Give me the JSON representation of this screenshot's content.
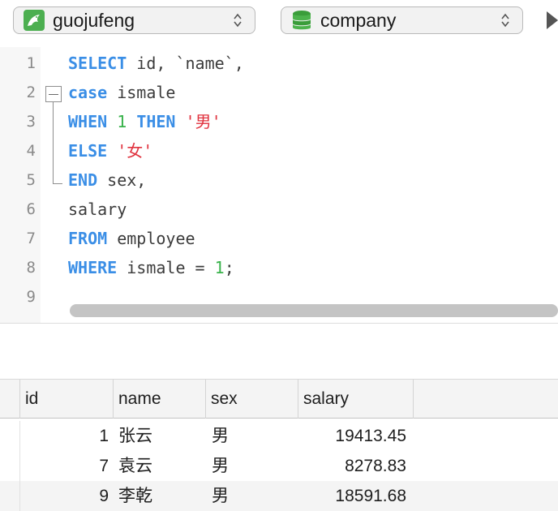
{
  "toolbar": {
    "connection": {
      "label": "guojufeng",
      "icon": "mysql-dolphin-icon"
    },
    "database": {
      "label": "company",
      "icon": "database-stack-icon"
    },
    "colors": {
      "connection_icon": "#4caf50",
      "database_icon": "#3a9d3a"
    }
  },
  "editor": {
    "line_numbers": [
      "1",
      "2",
      "3",
      "4",
      "5",
      "6",
      "7",
      "8",
      "9"
    ],
    "lines": [
      [
        {
          "t": "SELECT",
          "c": "kw"
        },
        {
          "t": " id, `name`,",
          "c": "plain"
        }
      ],
      [
        {
          "t": "case",
          "c": "kw"
        },
        {
          "t": " ismale",
          "c": "plain"
        }
      ],
      [
        {
          "t": "WHEN",
          "c": "kw"
        },
        {
          "t": " ",
          "c": "plain"
        },
        {
          "t": "1",
          "c": "num"
        },
        {
          "t": " ",
          "c": "plain"
        },
        {
          "t": "THEN",
          "c": "kw"
        },
        {
          "t": " ",
          "c": "plain"
        },
        {
          "t": "'男'",
          "c": "str"
        }
      ],
      [
        {
          "t": "ELSE",
          "c": "kw"
        },
        {
          "t": " ",
          "c": "plain"
        },
        {
          "t": "'女'",
          "c": "str"
        }
      ],
      [
        {
          "t": "END",
          "c": "kw"
        },
        {
          "t": " sex,",
          "c": "plain"
        }
      ],
      [
        {
          "t": "salary",
          "c": "plain"
        }
      ],
      [
        {
          "t": "FROM",
          "c": "kw"
        },
        {
          "t": " employee",
          "c": "plain"
        }
      ],
      [
        {
          "t": "WHERE",
          "c": "kw"
        },
        {
          "t": " ismale = ",
          "c": "plain"
        },
        {
          "t": "1",
          "c": "num"
        },
        {
          "t": ";",
          "c": "plain"
        }
      ],
      []
    ],
    "colors": {
      "keyword": "#3a8ee6",
      "number": "#38b24a",
      "string": "#e0323e"
    }
  },
  "results": {
    "columns": [
      "id",
      "name",
      "sex",
      "salary"
    ],
    "rows": [
      [
        "1",
        "张云",
        "男",
        "19413.45"
      ],
      [
        "7",
        "袁云",
        "男",
        "8278.83"
      ],
      [
        "9",
        "李乾",
        "男",
        "18591.68"
      ]
    ]
  }
}
